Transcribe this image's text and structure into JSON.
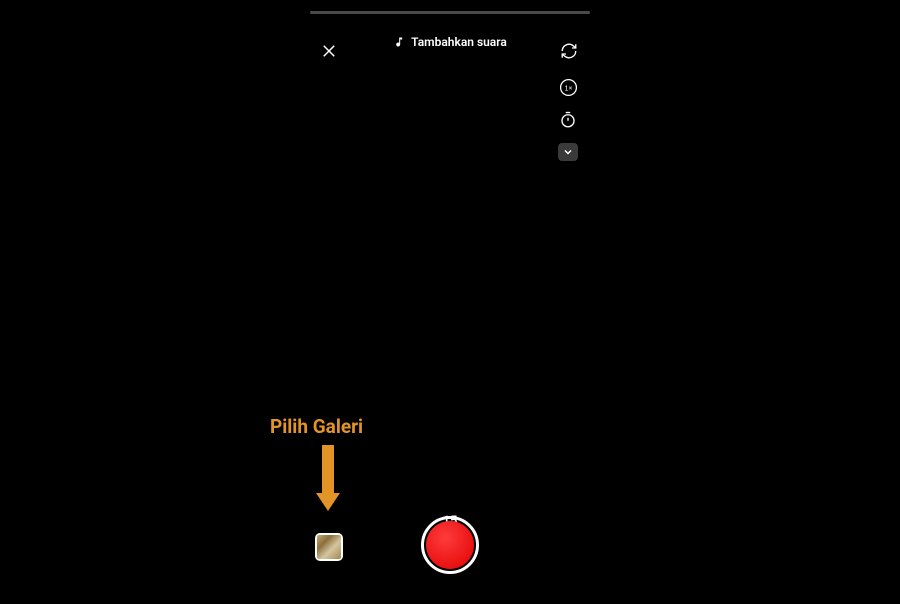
{
  "topBar": {
    "addSoundLabel": "Tambahkan suara"
  },
  "sideTools": {
    "speedLabel": "1×"
  },
  "bottom": {
    "durationLabel": "15"
  },
  "annotation": {
    "label": "Pilih Galeri"
  },
  "colors": {
    "accent": "#e29427",
    "record": "#ff0000"
  }
}
